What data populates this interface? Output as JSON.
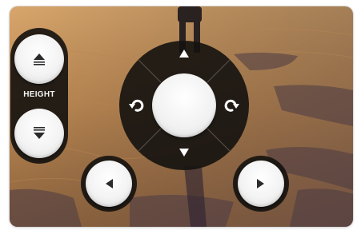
{
  "controls": {
    "height_label": "HEIGHT"
  },
  "colors": {
    "panel": "#141210",
    "button_face": "#f3f3f3",
    "glyph": "#2b2b2b",
    "dpad_glyph": "#ffffff"
  },
  "icons": {
    "height_up": "eject-up-icon",
    "height_down": "eject-down-icon",
    "forward": "triangle-up-icon",
    "back": "triangle-down-icon",
    "rotate_left": "rotate-left-icon",
    "rotate_right": "rotate-right-icon",
    "left": "triangle-left-icon",
    "right": "triangle-right-icon"
  }
}
